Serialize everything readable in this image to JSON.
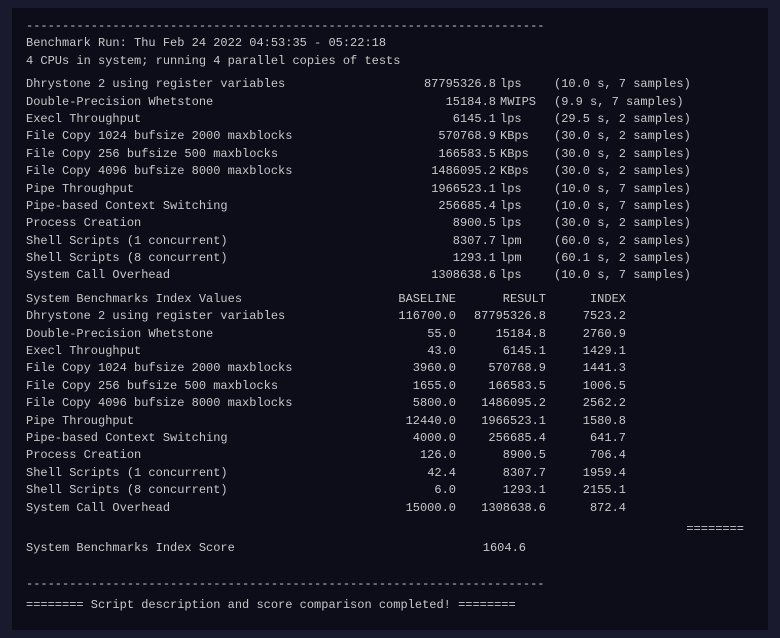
{
  "terminal": {
    "header": {
      "line1": "------------------------------------------------------------------------",
      "line2": "Benchmark Run: Thu Feb 24 2022 04:53:35 - 05:22:18",
      "line3": "4 CPUs in system; running 4 parallel copies of tests"
    },
    "benchmarks": [
      {
        "label": "Dhrystone 2 using register variables",
        "value": "87795326.8",
        "unit": "lps",
        "extra": "(10.0 s, 7 samples)"
      },
      {
        "label": "Double-Precision Whetstone",
        "value": "15184.8",
        "unit": "MWIPS",
        "extra": "(9.9 s, 7 samples)"
      },
      {
        "label": "Execl Throughput",
        "value": "6145.1",
        "unit": "lps",
        "extra": "(29.5 s, 2 samples)"
      },
      {
        "label": "File Copy 1024 bufsize 2000 maxblocks",
        "value": "570768.9",
        "unit": "KBps",
        "extra": "(30.0 s, 2 samples)"
      },
      {
        "label": "File Copy 256 bufsize 500 maxblocks",
        "value": "166583.5",
        "unit": "KBps",
        "extra": "(30.0 s, 2 samples)"
      },
      {
        "label": "File Copy 4096 bufsize 8000 maxblocks",
        "value": "1486095.2",
        "unit": "KBps",
        "extra": "(30.0 s, 2 samples)"
      },
      {
        "label": "Pipe Throughput",
        "value": "1966523.1",
        "unit": "lps",
        "extra": "(10.0 s, 7 samples)"
      },
      {
        "label": "Pipe-based Context Switching",
        "value": "256685.4",
        "unit": "lps",
        "extra": "(10.0 s, 7 samples)"
      },
      {
        "label": "Process Creation",
        "value": "8900.5",
        "unit": "lps",
        "extra": "(30.0 s, 2 samples)"
      },
      {
        "label": "Shell Scripts (1 concurrent)",
        "value": "8307.7",
        "unit": "lpm",
        "extra": "(60.0 s, 2 samples)"
      },
      {
        "label": "Shell Scripts (8 concurrent)",
        "value": "1293.1",
        "unit": "lpm",
        "extra": "(60.1 s, 2 samples)"
      },
      {
        "label": "System Call Overhead",
        "value": "1308638.6",
        "unit": "lps",
        "extra": "(10.0 s, 7 samples)"
      }
    ],
    "index_header": {
      "label": "System Benchmarks Index Values",
      "baseline": "BASELINE",
      "result": "RESULT",
      "index": "INDEX"
    },
    "index_rows": [
      {
        "label": "Dhrystone 2 using register variables",
        "baseline": "116700.0",
        "result": "87795326.8",
        "index": "7523.2"
      },
      {
        "label": "Double-Precision Whetstone",
        "baseline": "55.0",
        "result": "15184.8",
        "index": "2760.9"
      },
      {
        "label": "Execl Throughput",
        "baseline": "43.0",
        "result": "6145.1",
        "index": "1429.1"
      },
      {
        "label": "File Copy 1024 bufsize 2000 maxblocks",
        "baseline": "3960.0",
        "result": "570768.9",
        "index": "1441.3"
      },
      {
        "label": "File Copy 256 bufsize 500 maxblocks",
        "baseline": "1655.0",
        "result": "166583.5",
        "index": "1006.5"
      },
      {
        "label": "File Copy 4096 bufsize 8000 maxblocks",
        "baseline": "5800.0",
        "result": "1486095.2",
        "index": "2562.2"
      },
      {
        "label": "Pipe Throughput",
        "baseline": "12440.0",
        "result": "1966523.1",
        "index": "1580.8"
      },
      {
        "label": "Pipe-based Context Switching",
        "baseline": "4000.0",
        "result": "256685.4",
        "index": "641.7"
      },
      {
        "label": "Process Creation",
        "baseline": "126.0",
        "result": "8900.5",
        "index": "706.4"
      },
      {
        "label": "Shell Scripts (1 concurrent)",
        "baseline": "42.4",
        "result": "8307.7",
        "index": "1959.4"
      },
      {
        "label": "Shell Scripts (8 concurrent)",
        "baseline": "6.0",
        "result": "1293.1",
        "index": "2155.1"
      },
      {
        "label": "System Call Overhead",
        "baseline": "15000.0",
        "result": "1308638.6",
        "index": "872.4"
      }
    ],
    "equals_separator": "========",
    "score_label": "System Benchmarks Index Score",
    "score_value": "1604.6",
    "footer": "======== Script description and score comparison completed! ========"
  }
}
